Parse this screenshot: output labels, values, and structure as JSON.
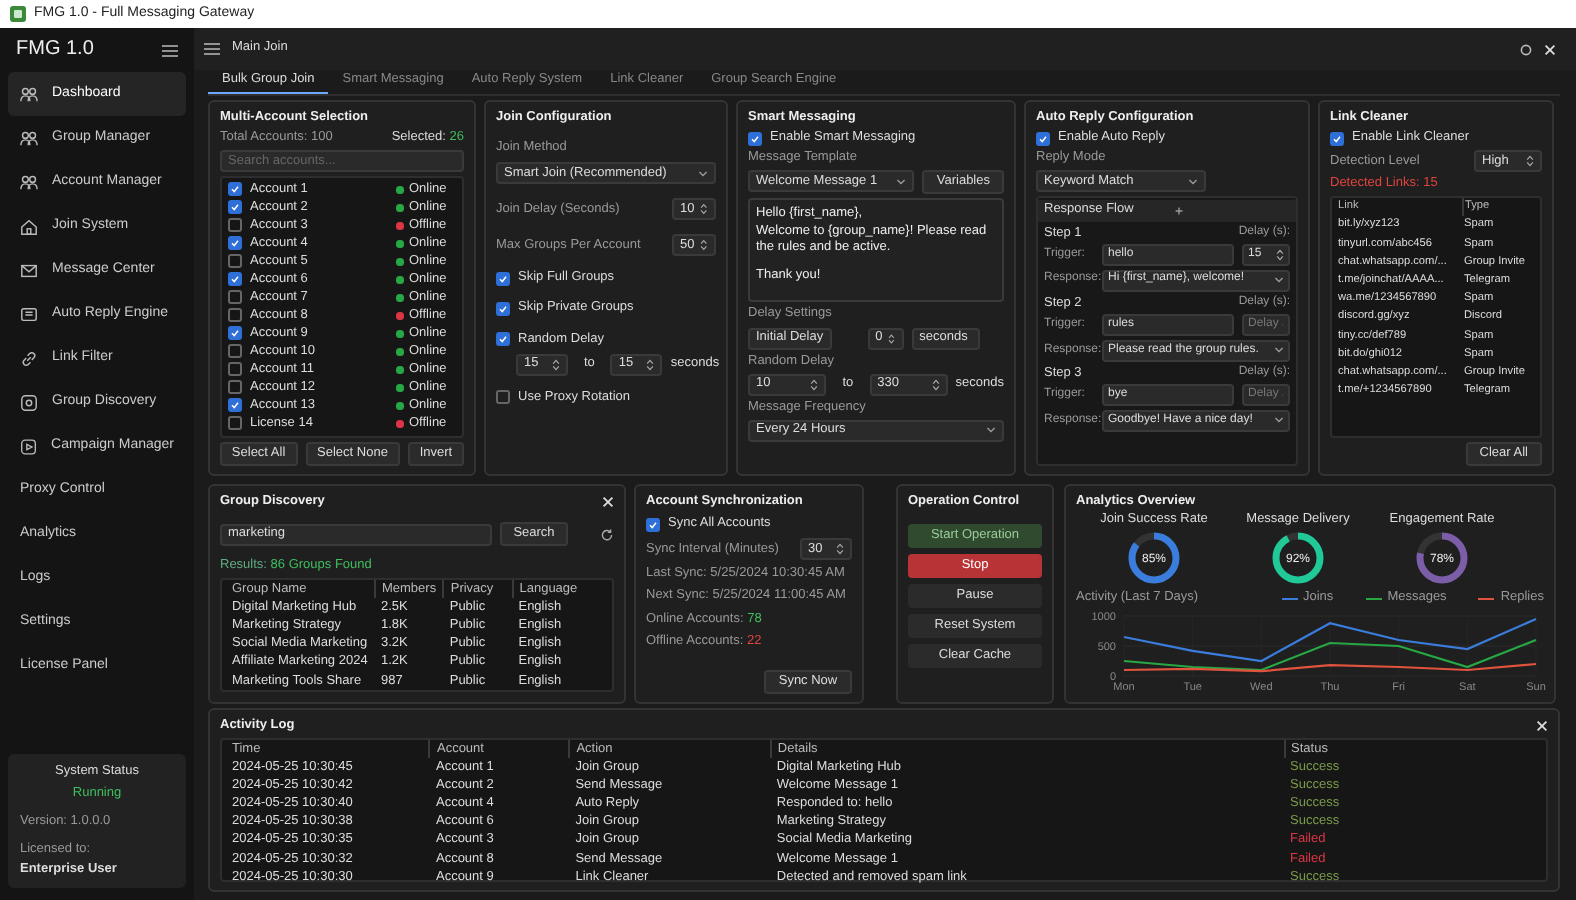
{
  "window": {
    "title": "FMG 1.0 - Full Messaging Gateway"
  },
  "sidebar": {
    "title": "FMG 1.0",
    "items": [
      {
        "label": "Dashboard",
        "selected": true
      },
      {
        "label": "Group Manager",
        "selected": false
      },
      {
        "label": "Account Manager",
        "selected": false
      },
      {
        "label": "Join System",
        "selected": false
      },
      {
        "label": "Message Center",
        "selected": false
      },
      {
        "label": "Auto Reply Engine",
        "selected": false
      },
      {
        "label": "Link Filter",
        "selected": false
      },
      {
        "label": "Group Discovery",
        "selected": false
      },
      {
        "label": "Campaign Manager",
        "selected": false
      },
      {
        "label": "Proxy Control",
        "selected": false
      },
      {
        "label": "Analytics",
        "selected": false
      },
      {
        "label": "Logs",
        "selected": false
      },
      {
        "label": "Settings",
        "selected": false
      },
      {
        "label": "License Panel",
        "selected": false
      }
    ],
    "system_status": {
      "title": "System Status",
      "state": "Running",
      "version": "Version: 1.0.0.0",
      "licensed_label": "Licensed to:",
      "licensee": "Enterprise User"
    }
  },
  "topbar": {
    "title": "Main Join"
  },
  "tabs": [
    {
      "label": "Bulk Group Join",
      "selected": true
    },
    {
      "label": "Smart Messaging",
      "selected": false
    },
    {
      "label": "Auto Reply System",
      "selected": false
    },
    {
      "label": "Link Cleaner",
      "selected": false
    },
    {
      "label": "Group Search Engine",
      "selected": false
    }
  ],
  "multi_account": {
    "title": "Multi-Account Selection",
    "total": "Total Accounts: 100",
    "selected_label": "Selected: ",
    "selected_count": "26",
    "search_placeholder": "Search accounts...",
    "accounts": [
      {
        "name": "Account 1",
        "checked": true,
        "status": "Online",
        "color": "#28a745"
      },
      {
        "name": "Account 2",
        "checked": true,
        "status": "Online",
        "color": "#28a745"
      },
      {
        "name": "Account 3",
        "checked": false,
        "status": "Offline",
        "color": "#dc3545"
      },
      {
        "name": "Account 4",
        "checked": true,
        "status": "Online",
        "color": "#28a745"
      },
      {
        "name": "Account 5",
        "checked": false,
        "status": "Online",
        "color": "#28a745"
      },
      {
        "name": "Account 6",
        "checked": true,
        "status": "Online",
        "color": "#28a745"
      },
      {
        "name": "Account 7",
        "checked": false,
        "status": "Online",
        "color": "#28a745"
      },
      {
        "name": "Account 8",
        "checked": false,
        "status": "Offline",
        "color": "#dc3545"
      },
      {
        "name": "Account 9",
        "checked": true,
        "status": "Online",
        "color": "#28a745"
      },
      {
        "name": "Account 10",
        "checked": false,
        "status": "Online",
        "color": "#28a745"
      },
      {
        "name": "Account 11",
        "checked": false,
        "status": "Online",
        "color": "#28a745"
      },
      {
        "name": "Account 12",
        "checked": false,
        "status": "Online",
        "color": "#28a745"
      },
      {
        "name": "Account 13",
        "checked": true,
        "status": "Online",
        "color": "#28a745"
      },
      {
        "name": "License 14",
        "checked": false,
        "status": "Offline",
        "color": "#dc3545"
      }
    ],
    "buttons": [
      "Select All",
      "Select None",
      "Invert"
    ]
  },
  "join_config": {
    "title": "Join Configuration",
    "method_label": "Join Method",
    "method": "Smart Join (Recommended)",
    "fields": [
      {
        "label": "Join Delay (Seconds)",
        "value": "10"
      },
      {
        "label": "Max Groups Per Account",
        "value": "50"
      }
    ],
    "options": [
      {
        "label": "Skip Full Groups",
        "checked": true
      },
      {
        "label": "Skip Private Groups",
        "checked": true
      },
      {
        "label": "Random Delay",
        "checked": true,
        "range": {
          "from": "15",
          "to_label": "to",
          "to": "15",
          "unit": "seconds"
        }
      },
      {
        "label": "Use Proxy Rotation",
        "checked": false
      }
    ]
  },
  "smart_messaging": {
    "title": "Smart Messaging",
    "enable_label": "Enable Smart Messaging",
    "enabled": true,
    "template_label": "Message Template",
    "template": "Welcome Message 1",
    "variables_button": "Variables",
    "message": [
      "Hello {first_name},",
      "Welcome to {group_name}! Please read the rules and be active.",
      "Thank you!"
    ],
    "delay_label": "Delay Settings",
    "initial_delay": "Initial Delay",
    "delay_value": "0",
    "delay_unit": "seconds",
    "random_label": "Random Delay",
    "random_from": "10",
    "random_to_label": "to",
    "random_to": "330",
    "random_unit": "seconds",
    "frequency_label": "Message Frequency",
    "frequency": "Every 24 Hours"
  },
  "auto_reply": {
    "title": "Auto Reply Configuration",
    "enable_label": "Enable Auto Reply",
    "enabled": true,
    "mode_label": "Reply Mode",
    "mode": "Keyword Match",
    "flow_label": "Response Flow",
    "steps": [
      {
        "title": "Step 1",
        "delay_label": "Delay (s):",
        "trigger_label": "Trigger:",
        "trigger": "hello",
        "delay": "15",
        "response_label": "Response:",
        "response": "Hi {first_name}, welcome!"
      },
      {
        "title": "Step 2",
        "delay_label": "Delay (s):",
        "trigger_label": "Trigger:",
        "trigger": "rules",
        "delay_placeholder": "Delay",
        "response_label": "Response:",
        "response": "Please read the group rules."
      },
      {
        "title": "Step 3",
        "delay_label": "Delay (s):",
        "trigger_label": "Trigger:",
        "trigger": "bye",
        "delay_placeholder": "Delay",
        "response_label": "Response:",
        "response": "Goodbye! Have a nice day!"
      }
    ]
  },
  "link_cleaner": {
    "title": "Link Cleaner",
    "enable_label": "Enable Link Cleaner",
    "enabled": true,
    "detection_label": "Detection Level",
    "detection_level": "High",
    "detected": "Detected Links: 15",
    "columns": [
      "Link",
      "Type"
    ],
    "rows": [
      [
        "bit.ly/xyz123",
        "Spam"
      ],
      [
        "tinyurl.com/abc456",
        "Spam"
      ],
      [
        "chat.whatsapp.com/...",
        "Group Invite"
      ],
      [
        "t.me/joinchat/AAAA...",
        "Telegram"
      ],
      [
        "wa.me/1234567890",
        "Spam"
      ],
      [
        "discord.gg/xyz",
        "Discord"
      ],
      [
        "tiny.cc/def789",
        "Spam"
      ],
      [
        "bit.do/ghi012",
        "Spam"
      ],
      [
        "chat.whatsapp.com/...",
        "Group Invite"
      ],
      [
        "t.me/+1234567890",
        "Telegram"
      ]
    ],
    "clear_button": "Clear All"
  },
  "group_discovery": {
    "title": "Group Discovery",
    "query": "marketing",
    "search_button": "Search",
    "results_label": "Results: ",
    "results": "86 Groups Found",
    "columns": [
      "Group Name",
      "Members",
      "Privacy",
      "Language"
    ],
    "rows": [
      [
        "Digital Marketing Hub",
        "2.5K",
        "Public",
        "English"
      ],
      [
        "Marketing Strategy",
        "1.8K",
        "Public",
        "English"
      ],
      [
        "Social Media Marketing",
        "3.2K",
        "Public",
        "English"
      ],
      [
        "Affiliate Marketing 2024",
        "1.2K",
        "Public",
        "English"
      ],
      [
        "Marketing Tools Share",
        "987",
        "Public",
        "English"
      ]
    ]
  },
  "account_sync": {
    "title": "Account Synchronization",
    "sync_all_label": "Sync All Accounts",
    "sync_all": true,
    "interval_label": "Sync Interval (Minutes)",
    "interval": "30",
    "last_sync": "Last Sync: 5/25/2024 10:30:45 AM",
    "next_sync": "Next Sync: 5/25/2024 11:00:45 AM",
    "online_label": "Online Accounts: ",
    "online": "78",
    "offline_label": "Offline Accounts: ",
    "offline": "22",
    "button": "Sync Now"
  },
  "operation_control": {
    "title": "Operation Control",
    "buttons": [
      {
        "label": "Start Operation",
        "kind": "start"
      },
      {
        "label": "Stop",
        "kind": "stop"
      },
      {
        "label": "Pause",
        "kind": "neutral"
      },
      {
        "label": "Reset System",
        "kind": "neutral"
      },
      {
        "label": "Clear Cache",
        "kind": "neutral"
      }
    ]
  },
  "analytics": {
    "title": "Analytics Overview",
    "gauges": [
      {
        "label": "Join Success Rate",
        "level": 0.85,
        "reading": "85%",
        "color": "#3b7ddd"
      },
      {
        "label": "Message Delivery",
        "level": 0.92,
        "reading": "92%",
        "color": "#20c997"
      },
      {
        "label": "Engagement Rate",
        "level": 0.78,
        "reading": "78%",
        "color": "#7b5ea7"
      }
    ],
    "chart_data": {
      "type": "line",
      "title": "Activity (Last 7 Days)",
      "categories": [
        "Mon",
        "Tue",
        "Wed",
        "Thu",
        "Fri",
        "Sat",
        "Sun"
      ],
      "ylim": [
        0,
        1000
      ],
      "yticks": [
        0,
        500,
        1000
      ],
      "series": [
        {
          "name": "Joins",
          "color": "#3b7ddd",
          "values": [
            650,
            420,
            250,
            880,
            600,
            450,
            950
          ]
        },
        {
          "name": "Messages",
          "color": "#28a745",
          "values": [
            250,
            150,
            100,
            550,
            500,
            150,
            600
          ]
        },
        {
          "name": "Replies",
          "color": "#e0533d",
          "values": [
            100,
            120,
            80,
            180,
            150,
            100,
            200
          ]
        }
      ]
    }
  },
  "activity_log": {
    "title": "Activity Log",
    "columns": [
      "Time",
      "Account",
      "Action",
      "Details",
      "Status"
    ],
    "rows": [
      {
        "time": "2024-05-25 10:30:45",
        "account": "Account 1",
        "action": "Join Group",
        "details": "Digital Marketing Hub",
        "status": "Success",
        "color": "#7a9a4a"
      },
      {
        "time": "2024-05-25 10:30:42",
        "account": "Account 2",
        "action": "Send Message",
        "details": "Welcome Message 1",
        "status": "Success",
        "color": "#7a9a4a"
      },
      {
        "time": "2024-05-25 10:30:40",
        "account": "Account 4",
        "action": "Auto Reply",
        "details": "Responded to: hello",
        "status": "Success",
        "color": "#7a9a4a"
      },
      {
        "time": "2024-05-25 10:30:38",
        "account": "Account 6",
        "action": "Join Group",
        "details": "Marketing Strategy",
        "status": "Success",
        "color": "#7a9a4a"
      },
      {
        "time": "2024-05-25 10:30:35",
        "account": "Account 3",
        "action": "Join Group",
        "details": "Social Media Marketing",
        "status": "Failed",
        "color": "#dc3545"
      },
      {
        "time": "2024-05-25 10:30:32",
        "account": "Account 8",
        "action": "Send Message",
        "details": "Welcome Message 1",
        "status": "Failed",
        "color": "#dc3545"
      },
      {
        "time": "2024-05-25 10:30:30",
        "account": "Account 9",
        "action": "Link Cleaner",
        "details": "Detected and removed spam link",
        "status": "Success",
        "color": "#7a9a4a"
      }
    ]
  }
}
